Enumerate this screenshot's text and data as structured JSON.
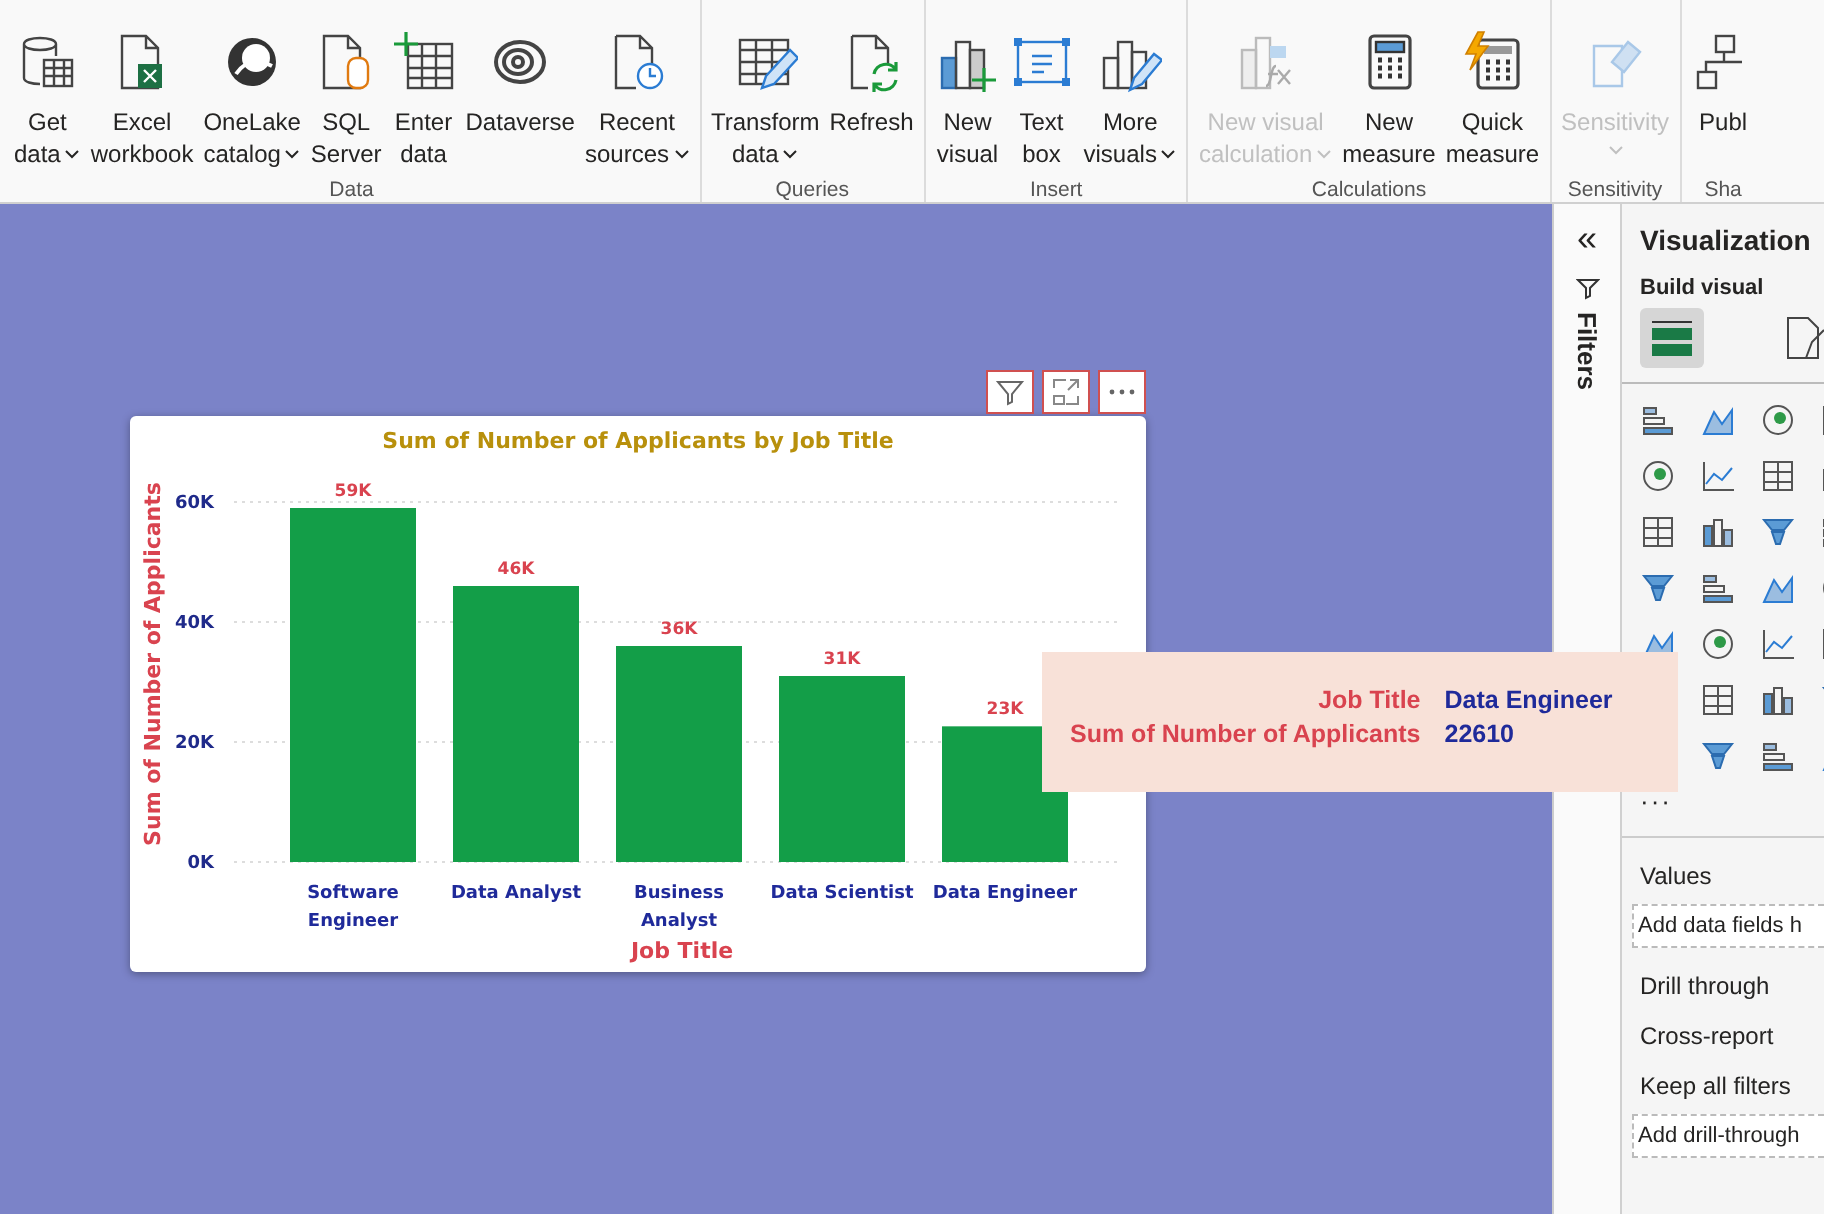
{
  "ribbon": {
    "groups": [
      {
        "label": "Data",
        "buttons": [
          {
            "lines": [
              "Get",
              "data"
            ],
            "dropdown": true,
            "disabled": false
          },
          {
            "lines": [
              "Excel",
              "workbook"
            ],
            "dropdown": false,
            "disabled": false
          },
          {
            "lines": [
              "OneLake",
              "catalog"
            ],
            "dropdown": true,
            "disabled": false
          },
          {
            "lines": [
              "SQL",
              "Server"
            ],
            "dropdown": false,
            "disabled": false
          },
          {
            "lines": [
              "Enter",
              "data"
            ],
            "dropdown": false,
            "disabled": false
          },
          {
            "lines": [
              "Dataverse"
            ],
            "dropdown": false,
            "disabled": false
          },
          {
            "lines": [
              "Recent",
              "sources"
            ],
            "dropdown": true,
            "disabled": false
          }
        ]
      },
      {
        "label": "Queries",
        "buttons": [
          {
            "lines": [
              "Transform",
              "data"
            ],
            "dropdown": true,
            "disabled": false
          },
          {
            "lines": [
              "Refresh"
            ],
            "dropdown": false,
            "disabled": false
          }
        ]
      },
      {
        "label": "Insert",
        "buttons": [
          {
            "lines": [
              "New",
              "visual"
            ],
            "dropdown": false,
            "disabled": false
          },
          {
            "lines": [
              "Text",
              "box"
            ],
            "dropdown": false,
            "disabled": false
          },
          {
            "lines": [
              "More",
              "visuals"
            ],
            "dropdown": true,
            "disabled": false
          }
        ]
      },
      {
        "label": "Calculations",
        "buttons": [
          {
            "lines": [
              "New visual",
              "calculation"
            ],
            "dropdown": true,
            "disabled": true
          },
          {
            "lines": [
              "New",
              "measure"
            ],
            "dropdown": false,
            "disabled": false
          },
          {
            "lines": [
              "Quick",
              "measure"
            ],
            "dropdown": false,
            "disabled": false
          }
        ]
      },
      {
        "label": "Sensitivity",
        "buttons": [
          {
            "lines": [
              "Sensitivity"
            ],
            "dropdown": true,
            "disabled": true
          }
        ]
      },
      {
        "label": "Sha",
        "buttons": [
          {
            "lines": [
              "Publ"
            ],
            "dropdown": false,
            "disabled": false
          }
        ]
      }
    ]
  },
  "chart": {
    "chart_data": {
      "type": "bar",
      "title": "Sum of Number of Applicants by Job Title",
      "xlabel": "Job Title",
      "ylabel": "Sum of Number of Applicants",
      "categories": [
        "Software Engineer",
        "Data Analyst",
        "Business Analyst",
        "Data Scientist",
        "Data Engineer"
      ],
      "series": [
        {
          "color": "#139e48",
          "values": [
            59000,
            46000,
            36000,
            31000,
            22610
          ]
        }
      ],
      "ylim": [
        0,
        60000
      ],
      "yticks": [
        {
          "value": 0,
          "label": "0K"
        },
        {
          "value": 20000,
          "label": "20K"
        },
        {
          "value": 40000,
          "label": "40K"
        },
        {
          "value": 60000,
          "label": "60K"
        }
      ],
      "value_labels": [
        "59K",
        "46K",
        "36K",
        "31K",
        "23K"
      ]
    }
  },
  "tooltip": {
    "rows": [
      {
        "label": "Job Title",
        "value": "Data Engineer"
      },
      {
        "label": "Sum of Number of Applicants",
        "value": "22610"
      }
    ]
  },
  "filters_pane": {
    "collapse": "«",
    "label": "Filters"
  },
  "visualizations_pane": {
    "title": "Visualization",
    "subtitle": "Build visual",
    "build_tabs": [
      {
        "selected": true
      },
      {
        "selected": false
      }
    ],
    "more": "···",
    "sections": [
      {
        "heading": "Values",
        "field": "Add data fields h"
      },
      {
        "heading": "Drill through",
        "options": [
          "Cross-report",
          "Keep all filters"
        ],
        "field": "Add drill-through"
      }
    ]
  }
}
